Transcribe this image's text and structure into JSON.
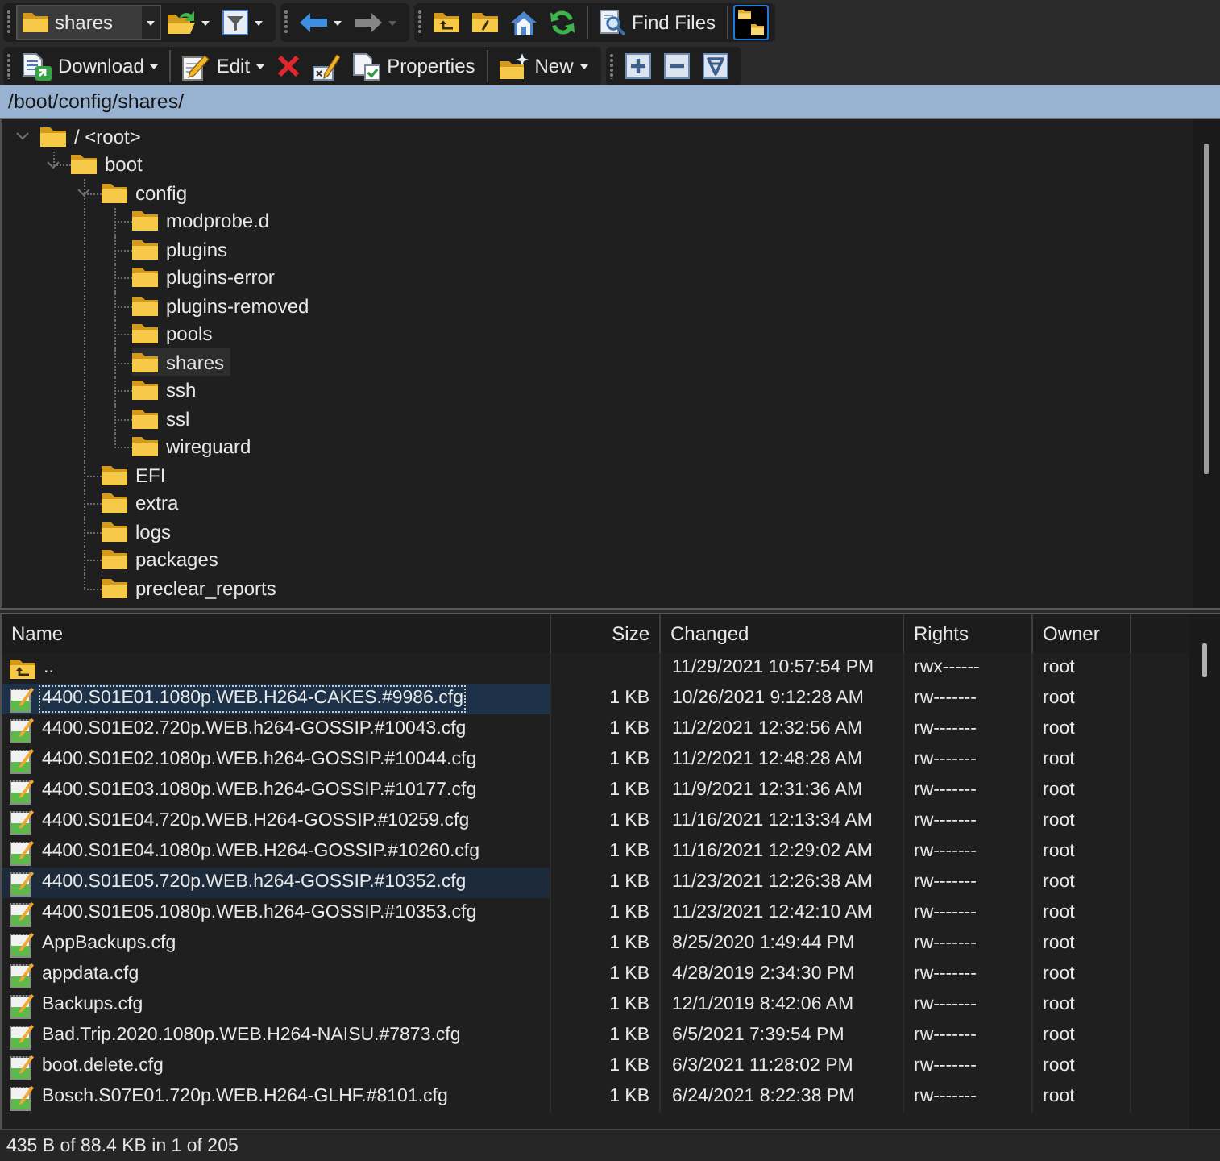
{
  "toolbars": [
    [
      {
        "items": [
          {
            "kind": "drive",
            "value": "shares",
            "dropdown": true,
            "disabled": false
          },
          {
            "kind": "open",
            "dropdown": true,
            "disabled": false
          },
          {
            "kind": "filter",
            "dropdown": true,
            "disabled": false
          }
        ]
      },
      {
        "items": [
          {
            "kind": "back",
            "dropdown": true,
            "disabled": false
          },
          {
            "kind": "forward",
            "dropdown": true,
            "disabled": true
          }
        ]
      },
      {
        "items": [
          {
            "kind": "parent",
            "dropdown": false,
            "disabled": false
          },
          {
            "kind": "root",
            "dropdown": false,
            "disabled": false
          },
          {
            "kind": "home",
            "dropdown": false,
            "disabled": false
          },
          {
            "kind": "refresh",
            "dropdown": false,
            "disabled": false
          },
          {
            "kind": "separator"
          },
          {
            "kind": "find",
            "label": "Find Files",
            "dropdown": false,
            "disabled": false
          },
          {
            "kind": "separator"
          },
          {
            "kind": "tree",
            "on": true,
            "dropdown": false,
            "disabled": false
          }
        ]
      }
    ],
    [
      {
        "items": [
          {
            "kind": "download",
            "label": "Download",
            "dropdown": true,
            "disabled": false
          },
          {
            "kind": "separator"
          },
          {
            "kind": "edit",
            "label": "Edit",
            "dropdown": true,
            "disabled": false
          },
          {
            "kind": "delete",
            "dropdown": false,
            "disabled": false
          },
          {
            "kind": "rename",
            "dropdown": false,
            "disabled": false
          },
          {
            "kind": "properties",
            "label": "Properties",
            "dropdown": false,
            "disabled": false
          },
          {
            "kind": "separator"
          },
          {
            "kind": "new",
            "label": "New",
            "dropdown": true,
            "disabled": false
          }
        ]
      },
      {
        "items": [
          {
            "kind": "select",
            "dropdown": false,
            "disabled": false
          },
          {
            "kind": "unselect",
            "dropdown": false,
            "disabled": false
          },
          {
            "kind": "mask",
            "dropdown": false,
            "disabled": false
          }
        ]
      }
    ]
  ],
  "path_bar": {
    "path": "/boot/config/shares/"
  },
  "tree": {
    "items": [
      {
        "label": "/ <root>",
        "expanded": true,
        "selected": false,
        "children": [
          {
            "label": "boot",
            "expanded": true,
            "selected": false,
            "children": [
              {
                "label": "config",
                "expanded": true,
                "selected": false,
                "children": [
                  {
                    "label": "modprobe.d",
                    "selected": false
                  },
                  {
                    "label": "plugins",
                    "selected": false
                  },
                  {
                    "label": "plugins-error",
                    "selected": false
                  },
                  {
                    "label": "plugins-removed",
                    "selected": false
                  },
                  {
                    "label": "pools",
                    "selected": false
                  },
                  {
                    "label": "shares",
                    "selected": true
                  },
                  {
                    "label": "ssh",
                    "selected": false
                  },
                  {
                    "label": "ssl",
                    "selected": false
                  },
                  {
                    "label": "wireguard",
                    "selected": false
                  }
                ]
              },
              {
                "label": "EFI",
                "selected": false
              },
              {
                "label": "extra",
                "selected": false
              },
              {
                "label": "logs",
                "selected": false
              },
              {
                "label": "packages",
                "selected": false
              },
              {
                "label": "preclear_reports",
                "selected": false
              }
            ]
          }
        ]
      }
    ]
  },
  "file_list": {
    "columns": [
      "Name",
      "Size",
      "Changed",
      "Rights",
      "Owner"
    ],
    "rows": [
      {
        "kind": "parent",
        "name": "..",
        "changed": "11/29/2021 10:57:54 PM",
        "rights": "rwx------",
        "owner": "root",
        "selected": false,
        "hovered": false
      },
      {
        "kind": "file",
        "name": "4400.S01E01.1080p.WEB.H264-CAKES.#9986.cfg",
        "size": "1 KB",
        "changed": "10/26/2021 9:12:28 AM",
        "rights": "rw-------",
        "owner": "root",
        "selected": true,
        "hovered": false
      },
      {
        "kind": "file",
        "name": "4400.S01E02.720p.WEB.h264-GOSSIP.#10043.cfg",
        "size": "1 KB",
        "changed": "11/2/2021 12:32:56 AM",
        "rights": "rw-------",
        "owner": "root",
        "selected": false,
        "hovered": false
      },
      {
        "kind": "file",
        "name": "4400.S01E02.1080p.WEB.h264-GOSSIP.#10044.cfg",
        "size": "1 KB",
        "changed": "11/2/2021 12:48:28 AM",
        "rights": "rw-------",
        "owner": "root",
        "selected": false,
        "hovered": false
      },
      {
        "kind": "file",
        "name": "4400.S01E03.1080p.WEB.h264-GOSSIP.#10177.cfg",
        "size": "1 KB",
        "changed": "11/9/2021 12:31:36 AM",
        "rights": "rw-------",
        "owner": "root",
        "selected": false,
        "hovered": false
      },
      {
        "kind": "file",
        "name": "4400.S01E04.720p.WEB.H264-GOSSIP.#10259.cfg",
        "size": "1 KB",
        "changed": "11/16/2021 12:13:34 AM",
        "rights": "rw-------",
        "owner": "root",
        "selected": false,
        "hovered": false
      },
      {
        "kind": "file",
        "name": "4400.S01E04.1080p.WEB.H264-GOSSIP.#10260.cfg",
        "size": "1 KB",
        "changed": "11/16/2021 12:29:02 AM",
        "rights": "rw-------",
        "owner": "root",
        "selected": false,
        "hovered": false
      },
      {
        "kind": "file",
        "name": "4400.S01E05.720p.WEB.h264-GOSSIP.#10352.cfg",
        "size": "1 KB",
        "changed": "11/23/2021 12:26:38 AM",
        "rights": "rw-------",
        "owner": "root",
        "selected": false,
        "hovered": true
      },
      {
        "kind": "file",
        "name": "4400.S01E05.1080p.WEB.h264-GOSSIP.#10353.cfg",
        "size": "1 KB",
        "changed": "11/23/2021 12:42:10 AM",
        "rights": "rw-------",
        "owner": "root",
        "selected": false,
        "hovered": false
      },
      {
        "kind": "file",
        "name": "AppBackups.cfg",
        "size": "1 KB",
        "changed": "8/25/2020 1:49:44 PM",
        "rights": "rw-------",
        "owner": "root",
        "selected": false,
        "hovered": false
      },
      {
        "kind": "file",
        "name": "appdata.cfg",
        "size": "1 KB",
        "changed": "4/28/2019 2:34:30 PM",
        "rights": "rw-------",
        "owner": "root",
        "selected": false,
        "hovered": false
      },
      {
        "kind": "file",
        "name": "Backups.cfg",
        "size": "1 KB",
        "changed": "12/1/2019 8:42:06 AM",
        "rights": "rw-------",
        "owner": "root",
        "selected": false,
        "hovered": false
      },
      {
        "kind": "file",
        "name": "Bad.Trip.2020.1080p.WEB.H264-NAISU.#7873.cfg",
        "size": "1 KB",
        "changed": "6/5/2021 7:39:54 PM",
        "rights": "rw-------",
        "owner": "root",
        "selected": false,
        "hovered": false
      },
      {
        "kind": "file",
        "name": "boot.delete.cfg",
        "size": "1 KB",
        "changed": "6/3/2021 11:28:02 PM",
        "rights": "rw-------",
        "owner": "root",
        "selected": false,
        "hovered": false
      },
      {
        "kind": "file",
        "name": "Bosch.S07E01.720p.WEB.H264-GLHF.#8101.cfg",
        "size": "1 KB",
        "changed": "6/24/2021 8:22:38 PM",
        "rights": "rw-------",
        "owner": "root",
        "selected": false,
        "hovered": false
      }
    ]
  },
  "status_bar": {
    "text": "435 B of 88.4 KB in 1 of 205"
  }
}
